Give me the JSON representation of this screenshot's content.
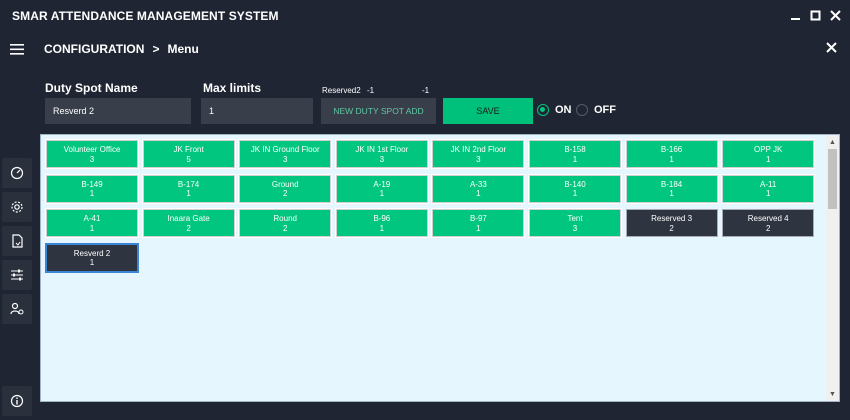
{
  "app": {
    "title": "SMAR ATTENDANCE MANAGEMENT SYSTEM",
    "controls": {
      "minimize": "▬",
      "maximize": "☐",
      "close": "✕"
    }
  },
  "breadcrumb": {
    "root": "CONFIGURATION",
    "sep": ">",
    "current": "Menu",
    "close": "✕"
  },
  "form": {
    "duty_spot_label": "Duty Spot Name",
    "duty_spot_value": "Resverd 2",
    "max_limits_label": "Max limits",
    "max_limits_value": "1",
    "reserved_label": "Reserved2",
    "reserved_val1": "-1",
    "reserved_val2": "-1",
    "new_button": "NEW DUTY SPOT ADD",
    "save_button": "SAVE",
    "on_label": "ON",
    "off_label": "OFF",
    "selected_state": "ON"
  },
  "tiles": [
    {
      "name": "Volunteer Office",
      "count": "3",
      "style": "green"
    },
    {
      "name": "JK Front",
      "count": "5",
      "style": "green"
    },
    {
      "name": "JK IN Ground Floor",
      "count": "3",
      "style": "green"
    },
    {
      "name": "JK IN 1st Floor",
      "count": "3",
      "style": "green"
    },
    {
      "name": "JK IN 2nd Floor",
      "count": "3",
      "style": "green"
    },
    {
      "name": "B-158",
      "count": "1",
      "style": "green"
    },
    {
      "name": "B-166",
      "count": "1",
      "style": "green"
    },
    {
      "name": "OPP JK",
      "count": "1",
      "style": "green"
    },
    {
      "name": "B-149",
      "count": "1",
      "style": "green"
    },
    {
      "name": "B-174",
      "count": "1",
      "style": "green"
    },
    {
      "name": "Ground",
      "count": "2",
      "style": "green"
    },
    {
      "name": "A-19",
      "count": "1",
      "style": "green"
    },
    {
      "name": "A-33",
      "count": "1",
      "style": "green"
    },
    {
      "name": "B-140",
      "count": "1",
      "style": "green"
    },
    {
      "name": "B-184",
      "count": "1",
      "style": "green"
    },
    {
      "name": "A-11",
      "count": "1",
      "style": "green"
    },
    {
      "name": "A-41",
      "count": "1",
      "style": "green"
    },
    {
      "name": "Inaara Gate",
      "count": "2",
      "style": "green"
    },
    {
      "name": "Round",
      "count": "2",
      "style": "green"
    },
    {
      "name": "B-96",
      "count": "1",
      "style": "green"
    },
    {
      "name": "B-97",
      "count": "1",
      "style": "green"
    },
    {
      "name": "Tent",
      "count": "3",
      "style": "green"
    },
    {
      "name": "Reserved 3",
      "count": "2",
      "style": "dark"
    },
    {
      "name": "Reserved 4",
      "count": "2",
      "style": "dark"
    },
    {
      "name": "Resverd 2",
      "count": "1",
      "style": "dark-selected"
    }
  ],
  "sidebar_icons": [
    "menu-icon",
    "dashboard-icon",
    "settings-icon",
    "document-icon",
    "sliders-icon",
    "user-settings-icon",
    "info-icon"
  ],
  "colors": {
    "accent": "#00c67f",
    "dark_tile": "#2e3440",
    "background": "#1f2532",
    "panel": "#e6f6ff"
  }
}
